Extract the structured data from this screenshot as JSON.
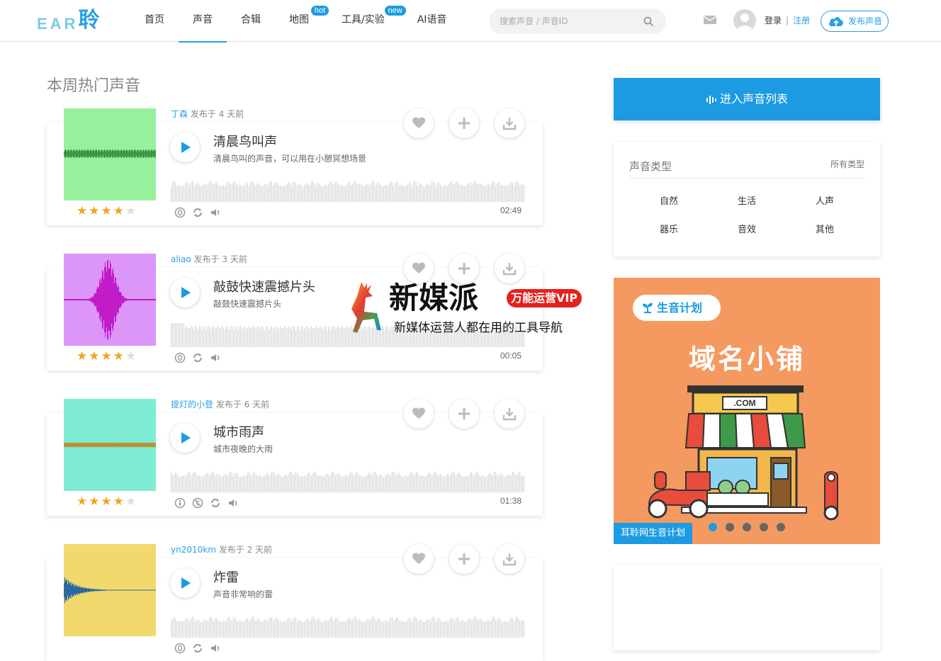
{
  "header": {
    "logo_latin": "EAR",
    "logo_cjk": "聆",
    "nav": [
      {
        "label": "首页",
        "badge": ""
      },
      {
        "label": "声音",
        "badge": "",
        "active": true
      },
      {
        "label": "合辑",
        "badge": ""
      },
      {
        "label": "地图",
        "badge": "hot"
      },
      {
        "label": "工具/实验",
        "badge": "new"
      },
      {
        "label": "AI语音",
        "badge": ""
      }
    ],
    "search_placeholder": "搜索声音 / 声音ID",
    "login": "登录",
    "separator": "|",
    "register": "注册",
    "publish": "发布声音"
  },
  "main": {
    "section_title": "本周热门声音",
    "posted_prefix": "发布于",
    "sounds": [
      {
        "user": "丁森",
        "posted": "4 天前",
        "title": "清晨鸟叫声",
        "desc": "清晨鸟叫的声音，可以用在小憩冥想场景",
        "duration": "02:49",
        "rating": 4,
        "cover_color": "#98f09c",
        "wave_color": "#3a9a4a",
        "license": "cc0"
      },
      {
        "user": "aliao",
        "posted": "3 天前",
        "title": "敲鼓快速震撼片头",
        "desc": "敲鼓快速震撼片头",
        "duration": "00:05",
        "rating": 4,
        "cover_color": "#dc96f8",
        "wave_color": "#c21cc8",
        "license": "cc0"
      },
      {
        "user": "提灯的小登",
        "posted": "6 天前",
        "title": "城市雨声",
        "desc": "城市夜晚的大雨",
        "duration": "01:38",
        "rating": 4,
        "cover_color": "#7eecd4",
        "wave_color": "#b8902e",
        "license": "cc-by-nc"
      },
      {
        "user": "yn2010km",
        "posted": "2 天前",
        "title": "炸雷",
        "desc": "声音非常响的雷",
        "duration": "",
        "rating": 0,
        "cover_color": "#f2d96e",
        "wave_color": "#2a6aa0",
        "license": "cc0"
      }
    ]
  },
  "sidebar": {
    "enter_label": "进入声音列表",
    "types_title": "声音类型",
    "types_all": "所有类型",
    "types": [
      "自然",
      "生活",
      "人声",
      "器乐",
      "音效",
      "其他"
    ],
    "ad": {
      "pill": "生音计划",
      "title": "域名小铺",
      "sign": ".COM",
      "caption": "耳聆网生音计划",
      "dots": 5,
      "active_dot": 0
    }
  },
  "watermark": {
    "name": "新媒派",
    "vip": "万能运营VIP",
    "sub": "新媒体运营人都在用的工具导航"
  },
  "colors": {
    "accent": "#28a0e4",
    "star": "#f0a51e",
    "ad_bg": "#f49a60"
  }
}
